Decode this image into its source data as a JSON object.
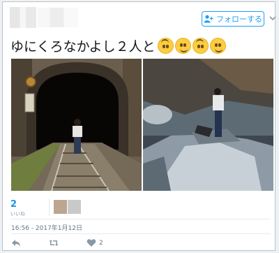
{
  "header": {
    "follow_label": "フォローする",
    "caret_icon": "chevron-down-icon",
    "follow_icon": "person-add-icon"
  },
  "tweet": {
    "text": "ゆにくろなかよし２人と",
    "emojis": [
      "upside-down-face",
      "slightly-smiling-face",
      "upside-down-face",
      "slightly-smiling-face"
    ]
  },
  "stats": {
    "likes_count": "2",
    "likes_label": "いいね"
  },
  "timestamp": "16:56 - 2017年1月12日",
  "actions": {
    "reply_icon": "reply-icon",
    "retweet_icon": "retweet-icon",
    "like_icon": "heart-icon",
    "like_count": "2"
  },
  "colors": {
    "accent": "#1da1f2",
    "text": "#14171a",
    "muted": "#657786"
  }
}
